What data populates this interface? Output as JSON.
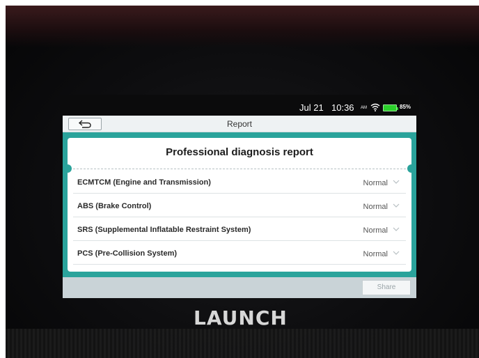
{
  "status_bar": {
    "date": "Jul 21",
    "time": "10:36",
    "ampm": "AM",
    "battery_percent": "85%",
    "wifi_icon": "wifi-icon",
    "battery_icon": "battery-icon",
    "battery_color": "#2bd12b"
  },
  "title_bar": {
    "title": "Report",
    "back_icon": "back-arrow-icon"
  },
  "report": {
    "heading": "Professional diagnosis report",
    "rows": [
      {
        "label": "ECMTCM (Engine and Transmission)",
        "status": "Normal"
      },
      {
        "label": "ABS (Brake Control)",
        "status": "Normal"
      },
      {
        "label": "SRS (Supplemental Inflatable Restraint System)",
        "status": "Normal"
      },
      {
        "label": "PCS (Pre-Collision System)",
        "status": "Normal"
      }
    ]
  },
  "footer": {
    "share_label": "Share"
  },
  "device": {
    "brand": "LAUNCH"
  },
  "colors": {
    "accent_teal": "#2aa39b",
    "footer_bg": "#c9d3d7"
  }
}
